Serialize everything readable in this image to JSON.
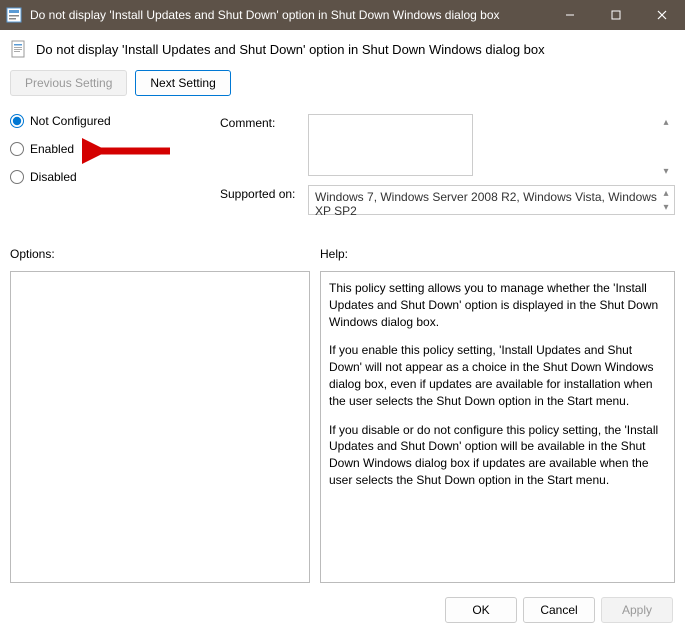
{
  "window": {
    "title": "Do not display 'Install Updates and Shut Down' option in Shut Down Windows dialog box"
  },
  "header": {
    "title": "Do not display 'Install Updates and Shut Down' option in Shut Down Windows dialog box"
  },
  "nav": {
    "previous": "Previous Setting",
    "next": "Next Setting"
  },
  "state": {
    "not_configured": "Not Configured",
    "enabled": "Enabled",
    "disabled": "Disabled",
    "selected": "not_configured"
  },
  "fields": {
    "comment_label": "Comment:",
    "comment_value": "",
    "supported_label": "Supported on:",
    "supported_value": "Windows 7, Windows Server 2008 R2, Windows Vista, Windows XP SP2"
  },
  "sections": {
    "options_label": "Options:",
    "help_label": "Help:"
  },
  "help": {
    "p1": "This policy setting allows you to manage whether the 'Install Updates and Shut Down' option is displayed in the Shut Down Windows dialog box.",
    "p2": "If you enable this policy setting, 'Install Updates and Shut Down' will not appear as a choice in the Shut Down Windows dialog box, even if updates are available for installation when the user selects the Shut Down option in the Start menu.",
    "p3": "If you disable or do not configure this policy setting, the 'Install Updates and Shut Down' option will be available in the Shut Down Windows dialog box if updates are available when the user selects the Shut Down option in the Start menu."
  },
  "footer": {
    "ok": "OK",
    "cancel": "Cancel",
    "apply": "Apply"
  },
  "annotation": {
    "arrow_color": "#d40000"
  }
}
